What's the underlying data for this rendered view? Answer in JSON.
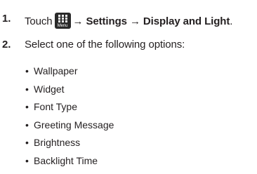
{
  "steps": [
    {
      "number": "1.",
      "prefix": "Touch",
      "icon": "menu-key-icon",
      "icon_label": "Menu",
      "path": "→ Settings → Display and Light",
      "suffix": "."
    },
    {
      "number": "2.",
      "text": "Select one of the following options:"
    }
  ],
  "options": [
    "Wallpaper",
    "Widget",
    "Font Type",
    "Greeting Message",
    "Brightness",
    "Backlight Time"
  ],
  "bullet": "•",
  "colors": {
    "text": "#231f20",
    "icon_bg": "#2a2a2a"
  }
}
